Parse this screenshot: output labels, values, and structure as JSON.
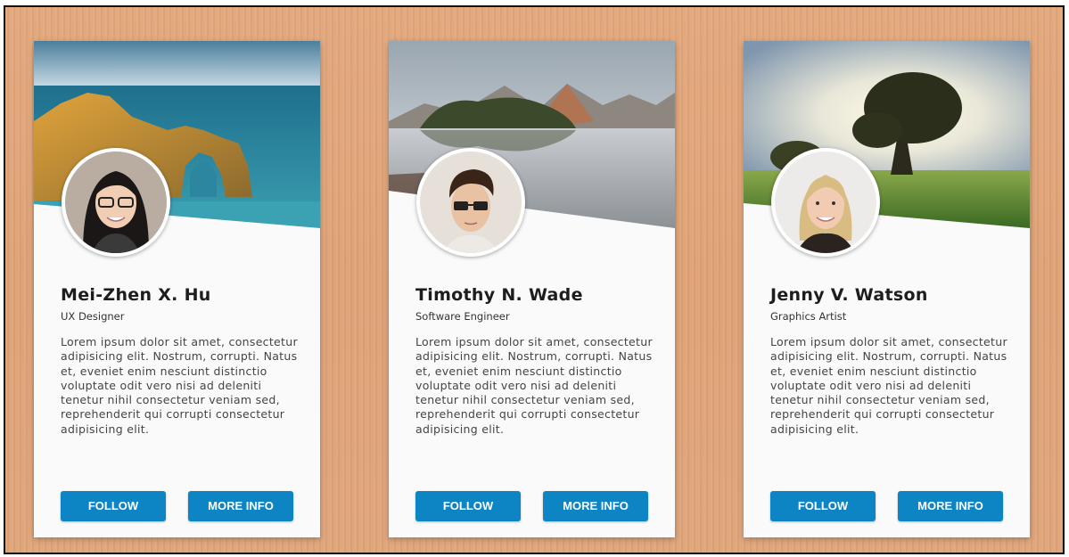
{
  "profiles": [
    {
      "name": "Mei-Zhen X. Hu",
      "role": "UX Designer",
      "bio": "Lorem ipsum dolor sit amet, consectetur adipisicing elit. Nostrum, corrupti. Natus et, eveniet enim nesciunt distinctio voluptate odit vero nisi ad deleniti tenetur nihil consectetur veniam sed, reprehenderit qui corrupti consectetur adipisicing elit.",
      "follow_label": "FOLLOW",
      "more_label": "MORE INFO",
      "banner_scene": "coastal-arch",
      "avatar_icon": "woman-with-glasses-avatar"
    },
    {
      "name": "Timothy N. Wade",
      "role": "Software Engineer",
      "bio": "Lorem ipsum dolor sit amet, consectetur adipisicing elit. Nostrum, corrupti. Natus et, eveniet enim nesciunt distinctio voluptate odit vero nisi ad deleniti tenetur nihil consectetur veniam sed, reprehenderit qui corrupti consectetur adipisicing elit.",
      "follow_label": "FOLLOW",
      "more_label": "MORE INFO",
      "banner_scene": "mountain-lake",
      "avatar_icon": "man-with-glasses-avatar"
    },
    {
      "name": "Jenny V. Watson",
      "role": "Graphics Artist",
      "bio": "Lorem ipsum dolor sit amet, consectetur adipisicing elit. Nostrum, corrupti. Natus et, eveniet enim nesciunt distinctio voluptate odit vero nisi ad deleniti tenetur nihil consectetur veniam sed, reprehenderit qui corrupti consectetur adipisicing elit.",
      "follow_label": "FOLLOW",
      "more_label": "MORE INFO",
      "banner_scene": "sunlit-tree-meadow",
      "avatar_icon": "blonde-woman-avatar"
    }
  ],
  "colors": {
    "button": "#0d85c4",
    "background": "#e0a57a",
    "card": "#fafafa"
  }
}
